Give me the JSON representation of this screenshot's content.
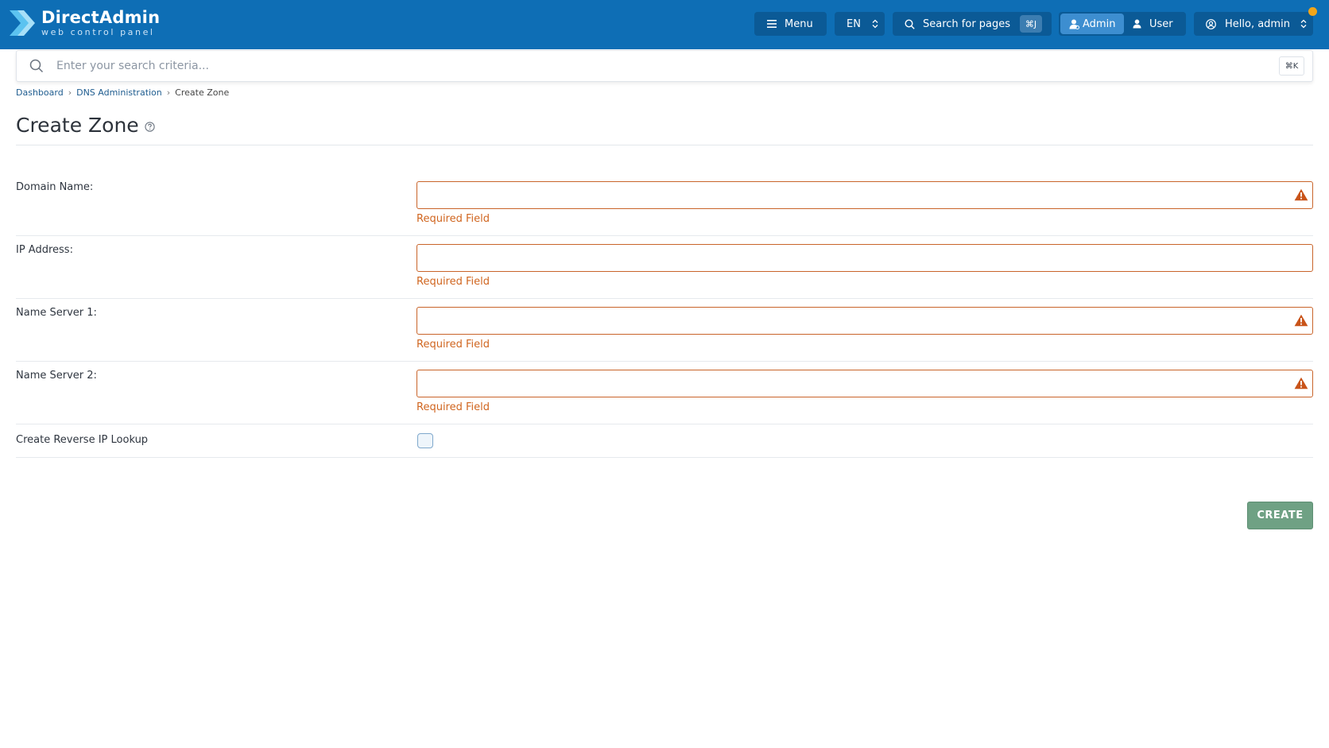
{
  "brand": {
    "title": "DirectAdmin",
    "subtitle": "web control panel"
  },
  "topbar": {
    "menu_label": "Menu",
    "language": "EN",
    "search_label": "Search for pages",
    "search_shortcut": "⌘J",
    "role_admin": "Admin",
    "role_user": "User",
    "active_role": "Admin",
    "greeting": "Hello, admin",
    "notification_color": "#f1a51a"
  },
  "search": {
    "placeholder": "Enter your search criteria...",
    "value": "",
    "shortcut": "⌘K"
  },
  "breadcrumb": {
    "items": [
      "Dashboard",
      "DNS Administration"
    ],
    "current": "Create Zone"
  },
  "page": {
    "title": "Create Zone"
  },
  "form": {
    "fields": [
      {
        "label": "Domain Name:",
        "value": "",
        "error": "Required Field"
      },
      {
        "label": "IP Address:",
        "value": "",
        "error": "Required Field"
      },
      {
        "label": "Name Server 1:",
        "value": "",
        "error": "Required Field"
      },
      {
        "label": "Name Server 2:",
        "value": "",
        "error": "Required Field"
      }
    ],
    "reverse_lookup": {
      "label": "Create Reverse IP Lookup",
      "checked": false
    },
    "submit_label": "CREATE"
  },
  "colors": {
    "header": "#0e6eb5",
    "error": "#d0651f",
    "submit": "#6fa184"
  }
}
